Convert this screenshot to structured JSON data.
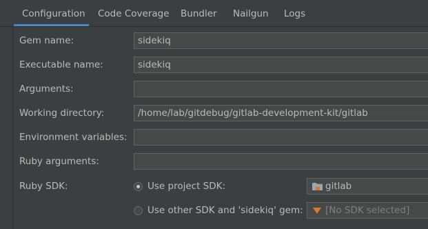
{
  "tabs": [
    {
      "label": "Configuration",
      "selected": true
    },
    {
      "label": "Code Coverage",
      "selected": false
    },
    {
      "label": "Bundler",
      "selected": false
    },
    {
      "label": "Nailgun",
      "selected": false
    },
    {
      "label": "Logs",
      "selected": false
    }
  ],
  "form": {
    "gem_name": {
      "label": "Gem name:",
      "value": "sidekiq"
    },
    "executable_name": {
      "label": "Executable name:",
      "value": "sidekiq"
    },
    "arguments": {
      "label": "Arguments:",
      "value": ""
    },
    "working_directory": {
      "label": "Working directory:",
      "value": "/home/lab/gitdebug/gitlab-development-kit/gitlab"
    },
    "environment_variables": {
      "label": "Environment variables:",
      "value": ""
    },
    "ruby_arguments": {
      "label": "Ruby arguments:",
      "value": ""
    }
  },
  "ruby_sdk": {
    "label": "Ruby SDK:",
    "use_project_sdk_label": "Use project SDK:",
    "use_project_sdk_selected": true,
    "project_sdk_value": "gitlab",
    "project_sdk_icon": "folder-icon",
    "use_other_sdk_label": "Use other SDK and 'sidekiq' gem:",
    "use_other_sdk_selected": false,
    "other_sdk_value": "[No SDK selected]",
    "other_sdk_icon": "sdk-warning-icon"
  },
  "colors": {
    "background": "#3c3f41",
    "field_background": "#45494a",
    "field_border": "#646464",
    "text": "#bbbbbb",
    "disabled_text": "#808080",
    "tab_underline": "#4a88c7",
    "sdk_warning": "#e0772f"
  }
}
